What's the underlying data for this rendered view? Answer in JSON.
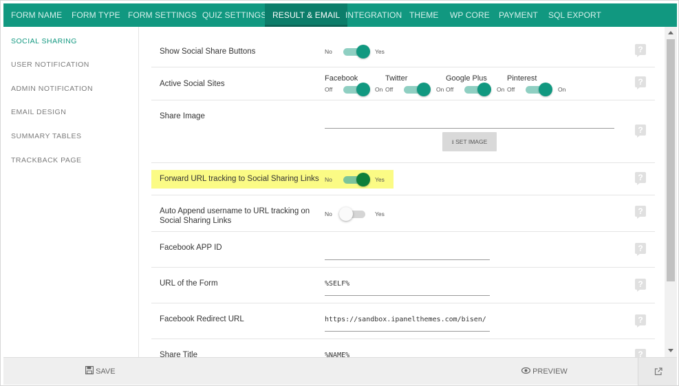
{
  "tabs": [
    "FORM NAME",
    "FORM TYPE",
    "FORM SETTINGS",
    "QUIZ SETTINGS",
    "RESULT & EMAIL",
    "INTEGRATION",
    "THEME",
    "WP CORE",
    "PAYMENT",
    "SQL EXPORT"
  ],
  "active_tab": "RESULT & EMAIL",
  "sidebar": {
    "items": [
      "SOCIAL SHARING",
      "USER NOTIFICATION",
      "ADMIN NOTIFICATION",
      "EMAIL DESIGN",
      "SUMMARY TABLES",
      "TRACKBACK PAGE"
    ],
    "active": "SOCIAL SHARING"
  },
  "switch_labels": {
    "no": "No",
    "yes": "Yes",
    "off": "Off",
    "on": "On"
  },
  "rows": {
    "show_share": {
      "label": "Show Social Share Buttons",
      "value": "Yes"
    },
    "active_sites": {
      "label": "Active Social Sites",
      "sites": [
        {
          "name": "Facebook",
          "value": "On"
        },
        {
          "name": "Twitter",
          "value": "On"
        },
        {
          "name": "Google Plus",
          "value": "On"
        },
        {
          "name": "Pinterest",
          "value": "On"
        }
      ]
    },
    "share_image": {
      "label": "Share Image",
      "value": "",
      "button": "SET IMAGE"
    },
    "forward_url": {
      "label": "Forward URL tracking to Social Sharing Links",
      "value": "Yes"
    },
    "auto_append": {
      "label_line1": "Auto Append username to URL tracking on",
      "label_line2": "Social Sharing Links",
      "value": "No"
    },
    "fb_app_id": {
      "label": "Facebook APP ID",
      "value": ""
    },
    "form_url": {
      "label": "URL of the Form",
      "value": "%SELF%"
    },
    "fb_redirect": {
      "label": "Facebook Redirect URL",
      "value": "https://sandbox.ipanelthemes.com/bisen/"
    },
    "share_title": {
      "label": "Share Title",
      "value": "%NAME%"
    }
  },
  "help_icon": "question-icon",
  "footer": {
    "save": "SAVE",
    "preview": "PREVIEW",
    "save_icon": "floppy-icon",
    "preview_icon": "eye-icon",
    "external_icon": "external-link-icon"
  },
  "colors": {
    "brand": "#119880",
    "highlight": "#fbfb85"
  }
}
